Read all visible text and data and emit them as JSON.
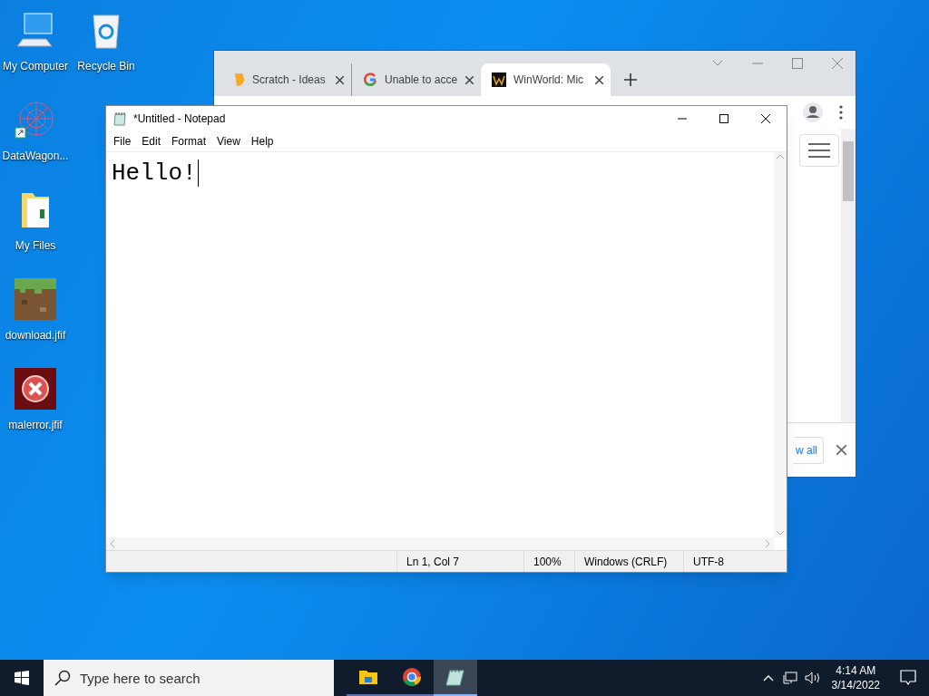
{
  "desktop_icons": [
    {
      "label": "My Computer",
      "kind": "computer"
    },
    {
      "label": "DataWagon...",
      "kind": "shortcut"
    },
    {
      "label": "My Files",
      "kind": "folder"
    },
    {
      "label": "download.jfif",
      "kind": "image"
    },
    {
      "label": "malerror.jfif",
      "kind": "error"
    },
    {
      "label": "Recycle Bin",
      "kind": "recycle"
    }
  ],
  "browser": {
    "tabs": [
      {
        "title": "Scratch - Ideas",
        "kind": "scratch",
        "selected": false
      },
      {
        "title": "Unable to acce",
        "kind": "google",
        "selected": false
      },
      {
        "title": "WinWorld: Mic",
        "kind": "winworld",
        "selected": true
      }
    ],
    "download_bar_button": "w all"
  },
  "notepad": {
    "title": "*Untitled - Notepad",
    "menu": [
      "File",
      "Edit",
      "Format",
      "View",
      "Help"
    ],
    "text": "Hello!",
    "status": [
      "Ln 1, Col 7",
      "100%",
      "Windows (CRLF)",
      "UTF-8"
    ]
  },
  "taskbar": {
    "search_placeholder": "Type here to search",
    "apps": [
      {
        "kind": "explorer",
        "selected": false
      },
      {
        "kind": "chrome",
        "selected": false
      },
      {
        "kind": "notepad",
        "selected": true
      }
    ],
    "time": "4:14 AM",
    "date": "3/14/2022"
  }
}
